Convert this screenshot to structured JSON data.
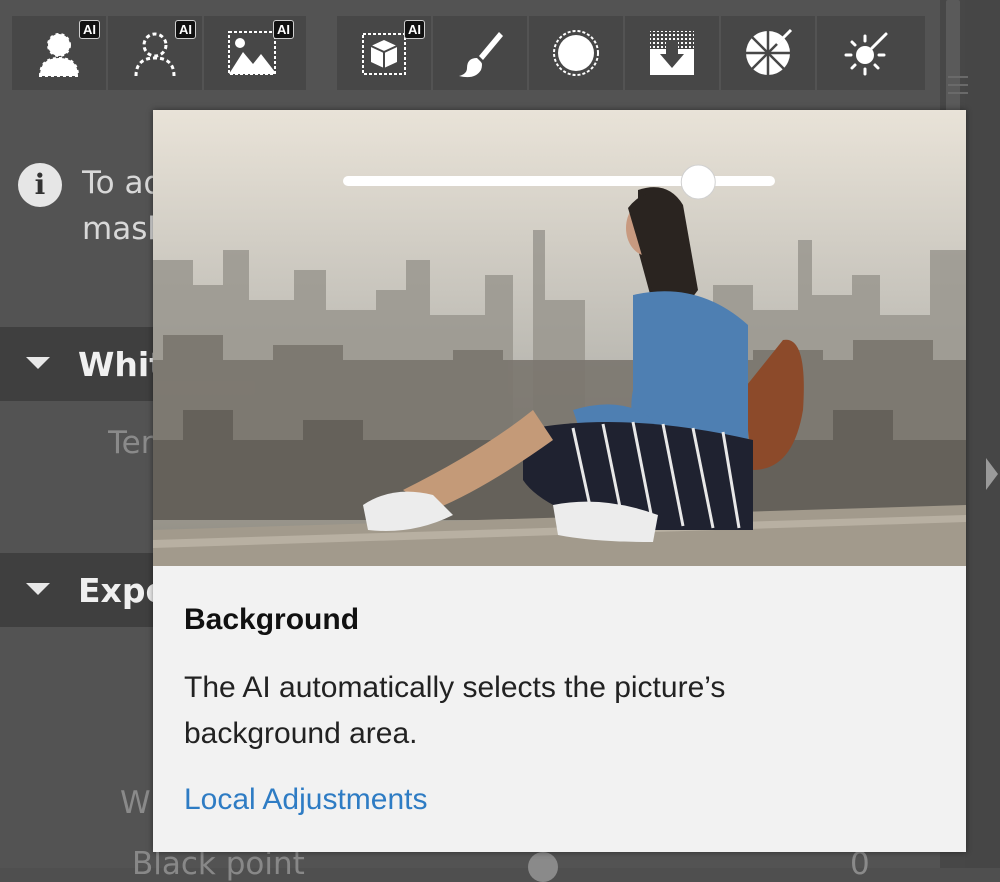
{
  "toolbar": {
    "group1": [
      {
        "name": "person-ai-tool",
        "icon": "person-solid-icon",
        "ai": "AI"
      },
      {
        "name": "person-outline-ai-tool",
        "icon": "person-outline-icon",
        "ai": "AI"
      },
      {
        "name": "background-ai-tool",
        "icon": "landscape-image-icon",
        "ai": "AI"
      }
    ],
    "group2": [
      {
        "name": "object-select-ai-tool",
        "icon": "cube-select-icon",
        "ai": "AI"
      },
      {
        "name": "brush-tool",
        "icon": "brush-icon"
      },
      {
        "name": "radial-tool",
        "icon": "circle-dashed-icon"
      },
      {
        "name": "gradient-tool",
        "icon": "gradient-arrow-icon"
      },
      {
        "name": "color-range-tool",
        "icon": "color-wheel-icon"
      },
      {
        "name": "auto-mask-tool",
        "icon": "magic-wand-icon"
      }
    ]
  },
  "info": {
    "line1": "To ad",
    "line2": "mask"
  },
  "sections": [
    {
      "title": "White"
    },
    {
      "title": "Exposure"
    }
  ],
  "faded_labels": {
    "temperature": "Tem",
    "white_label": "W",
    "black_point": "Black point",
    "black_point_value": "0"
  },
  "popover": {
    "title": "Background",
    "description": "The AI automatically selects the picture’s background area.",
    "link": "Local Adjustments",
    "slider_value": 0.83
  },
  "colors": {
    "panel": "#535353",
    "toolbar": "#474747",
    "popover_bg": "#f2f2f2",
    "link": "#2e7cc4"
  }
}
